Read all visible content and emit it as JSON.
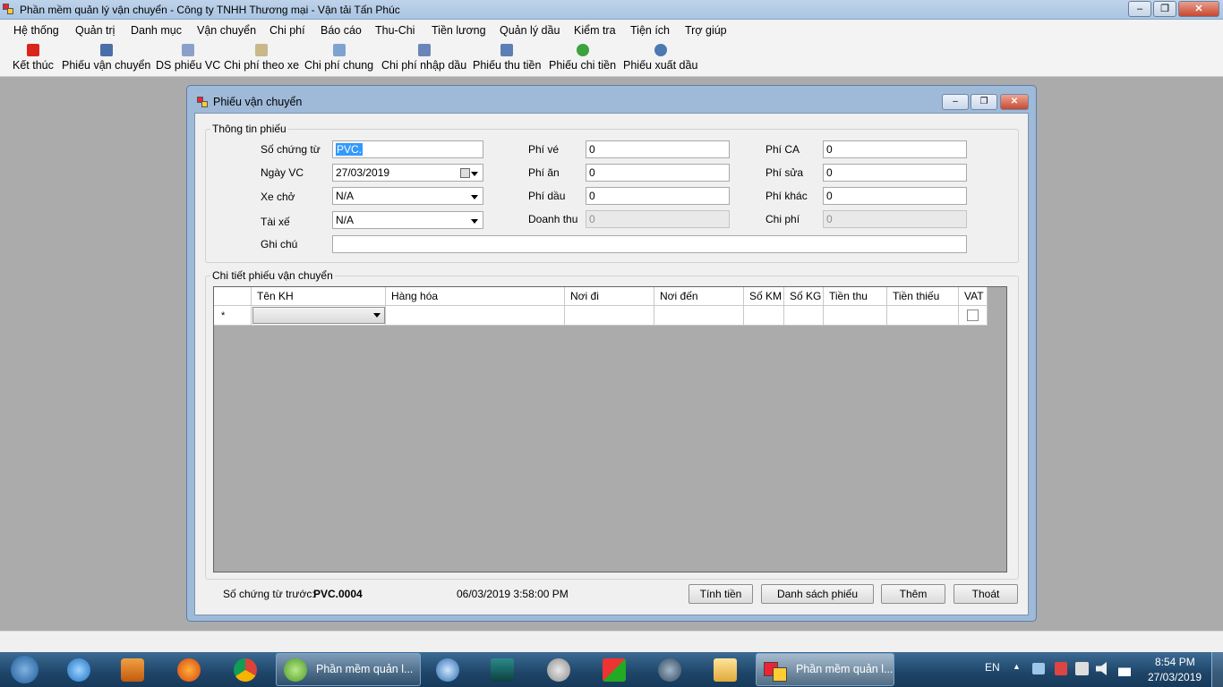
{
  "window": {
    "title": "Phần mềm quản lý vận chuyển - Công ty TNHH Thương mại - Vận tải Tấn Phúc"
  },
  "menubar": {
    "items": [
      "Hệ thống",
      "Quản trị",
      "Danh mục",
      "Vận chuyển",
      "Chi phí",
      "Báo cáo",
      "Thu-Chi",
      "Tiền lương",
      "Quản lý dầu",
      "Kiểm tra",
      "Tiện ích",
      "Trợ giúp"
    ]
  },
  "toolbar": {
    "items": [
      {
        "label": "Kết thúc",
        "icon": "power-icon"
      },
      {
        "label": "Phiếu vận chuyển",
        "icon": "truck-icon"
      },
      {
        "label": "DS phiếu VC",
        "icon": "list-icon"
      },
      {
        "label": "Chi phí theo xe",
        "icon": "note-icon"
      },
      {
        "label": "Chi phí chung",
        "icon": "document-icon"
      },
      {
        "label": "Chi phí nhập dầu",
        "icon": "oil-icon"
      },
      {
        "label": "Phiếu thu tiền",
        "icon": "receipt-icon"
      },
      {
        "label": "Phiếu chi tiền",
        "icon": "globe-icon"
      },
      {
        "label": "Phiếu xuất dầu",
        "icon": "search-icon"
      }
    ]
  },
  "form": {
    "title": "Phiếu vận chuyển",
    "group_info": "Thông tin phiếu",
    "fields": {
      "so_chung_tu": {
        "label": "Số chứng từ",
        "value": "PVC."
      },
      "ngay_vc": {
        "label": "Ngày VC",
        "value": "27/03/2019"
      },
      "xe_cho": {
        "label": "Xe chở",
        "value": "N/A"
      },
      "tai_xe": {
        "label": "Tài xế",
        "value": "N/A"
      },
      "ghi_chu": {
        "label": "Ghi chú",
        "value": ""
      },
      "phi_ve": {
        "label": "Phí vé",
        "value": "0"
      },
      "phi_an": {
        "label": "Phí ăn",
        "value": "0"
      },
      "phi_dau": {
        "label": "Phí dầu",
        "value": "0"
      },
      "doanh_thu": {
        "label": "Doanh thu",
        "value": "0"
      },
      "phi_ca": {
        "label": "Phí CA",
        "value": "0"
      },
      "phi_sua": {
        "label": "Phí sửa",
        "value": "0"
      },
      "phi_khac": {
        "label": "Phí khác",
        "value": "0"
      },
      "chi_phi": {
        "label": "Chi phí",
        "value": "0"
      }
    },
    "group_detail": "Chi tiết phiếu vận chuyển",
    "grid": {
      "columns": [
        "Tên KH",
        "Hàng hóa",
        "Nơi đi",
        "Nơi đến",
        "Số KM",
        "Số KG",
        "Tiền thu",
        "Tiền thiếu",
        "VAT"
      ],
      "new_row_marker": "*"
    },
    "footer": {
      "prev_label": "Số chứng từ trước:",
      "prev_value": "PVC.0004",
      "timestamp": "06/03/2019 3:58:00 PM",
      "buttons": {
        "calc": "Tính tiền",
        "list": "Danh sách phiếu",
        "add": "Thêm",
        "exit": "Thoát"
      }
    }
  },
  "taskbar": {
    "tasks": [
      "Phần mềm quản l...",
      "Phần mềm quản l..."
    ],
    "lang": "EN",
    "time": "8:54 PM",
    "date": "27/03/2019"
  },
  "colors": {
    "accent": "#3399ff",
    "taskbar": "#1e4568",
    "form_frame": "#9fb9d8"
  }
}
